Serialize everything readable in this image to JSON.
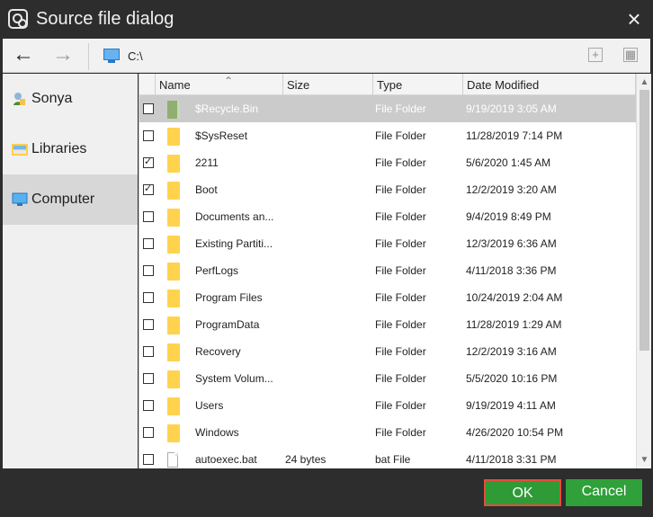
{
  "title": "Source file dialog",
  "icons": {
    "app": "dialog-icon",
    "close": "close-icon",
    "back": "arrow-left-icon",
    "forward": "arrow-right-icon",
    "path": "computer-icon",
    "new": "new-folder-icon",
    "view": "view-icon"
  },
  "toolbar": {
    "path": "C:\\",
    "back_glyph": "←",
    "forward_glyph": "→",
    "new_glyph": "+",
    "view_glyph": "▦"
  },
  "sidebar": {
    "items": [
      {
        "label": "Sonya",
        "icon": "user-icon"
      },
      {
        "label": "Libraries",
        "icon": "library-icon"
      },
      {
        "label": "Computer",
        "icon": "computer-icon",
        "active": true
      }
    ]
  },
  "table": {
    "headers": [
      "Name",
      "Size",
      "Type",
      "Date Modified"
    ],
    "rows": [
      {
        "name": "$Recycle.Bin",
        "size": "",
        "type": "File Folder",
        "date": "9/19/2019 3:05 AM",
        "checked": false,
        "icon": "recycle"
      },
      {
        "name": "$SysReset",
        "size": "",
        "type": "File Folder",
        "date": "11/28/2019 7:14 PM",
        "checked": false,
        "icon": "folder"
      },
      {
        "name": "2211",
        "size": "",
        "type": "File Folder",
        "date": "5/6/2020 1:45 AM",
        "checked": true,
        "icon": "folder"
      },
      {
        "name": "Boot",
        "size": "",
        "type": "File Folder",
        "date": "12/2/2019 3:20 AM",
        "checked": true,
        "icon": "folder"
      },
      {
        "name": "Documents an...",
        "size": "",
        "type": "File Folder",
        "date": "9/4/2019 8:49 PM",
        "checked": false,
        "icon": "folder"
      },
      {
        "name": "Existing Partiti...",
        "size": "",
        "type": "File Folder",
        "date": "12/3/2019 6:36 AM",
        "checked": false,
        "icon": "folder"
      },
      {
        "name": "PerfLogs",
        "size": "",
        "type": "File Folder",
        "date": "4/11/2018 3:36 PM",
        "checked": false,
        "icon": "folder"
      },
      {
        "name": "Program Files",
        "size": "",
        "type": "File Folder",
        "date": "10/24/2019 2:04 AM",
        "checked": false,
        "icon": "folder"
      },
      {
        "name": "ProgramData",
        "size": "",
        "type": "File Folder",
        "date": "11/28/2019 1:29 AM",
        "checked": false,
        "icon": "folder"
      },
      {
        "name": "Recovery",
        "size": "",
        "type": "File Folder",
        "date": "12/2/2019 3:16 AM",
        "checked": false,
        "icon": "folder"
      },
      {
        "name": "System Volum...",
        "size": "",
        "type": "File Folder",
        "date": "5/5/2020 10:16 PM",
        "checked": false,
        "icon": "folder"
      },
      {
        "name": "Users",
        "size": "",
        "type": "File Folder",
        "date": "9/19/2019 4:11 AM",
        "checked": false,
        "icon": "folder"
      },
      {
        "name": "Windows",
        "size": "",
        "type": "File Folder",
        "date": "4/26/2020 10:54 PM",
        "checked": false,
        "icon": "folder"
      },
      {
        "name": "autoexec.bat",
        "size": "24 bytes",
        "type": "bat File",
        "date": "4/11/2018 3:31 PM",
        "checked": false,
        "icon": "file"
      }
    ]
  },
  "buttons": {
    "ok": "OK",
    "cancel": "Cancel"
  },
  "colors": {
    "ok_bg": "#2f9b36",
    "ok_border": "#e64b3c",
    "selected_row": "#cbcbcb"
  }
}
